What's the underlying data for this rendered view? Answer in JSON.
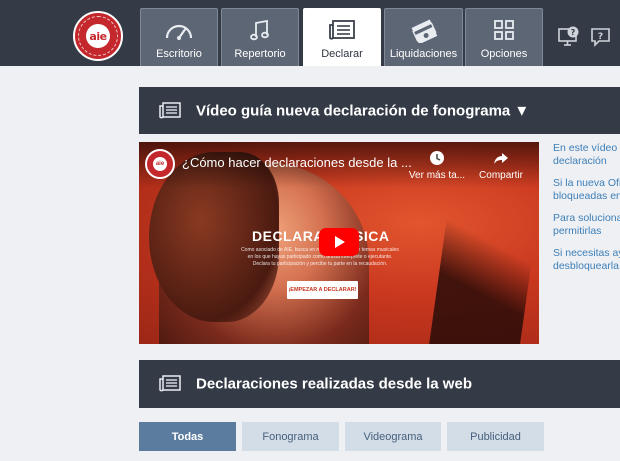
{
  "brand": {
    "logo_text": "aie"
  },
  "nav": {
    "tabs": [
      {
        "label": "Escritorio",
        "icon": "gauge-icon"
      },
      {
        "label": "Repertorio",
        "icon": "music-note-icon"
      },
      {
        "label": "Declarar",
        "icon": "document-list-icon",
        "active": true
      },
      {
        "label": "Liquidaciones",
        "icon": "money-stack-icon"
      },
      {
        "label": "Opciones",
        "icon": "grid-icon"
      }
    ],
    "right_icons": [
      "help-monitor-icon",
      "help-chat-icon"
    ]
  },
  "guide": {
    "title": "Vídeo guía nueva declaración de fonograma ▼"
  },
  "video": {
    "title": "¿Cómo hacer declaraciones desde la ...",
    "watch_later": "Ver más ta...",
    "share": "Compartir",
    "overlay_left": "DECLARA",
    "overlay_right": "SICA",
    "overlay_small": "Como asociado de AIE, busca en nuestro catálogo de temas musicales en los que hayas participado como artista intérprete o ejecutante. Declara tu participación y percibe tu parte en la recaudación.",
    "cta": "¡EMPEZAR A DECLARAR!"
  },
  "side_links": [
    {
      "lines": [
        "En este vídeo p",
        "declaración"
      ]
    },
    {
      "lines": [
        "Si la nueva Ofi",
        "bloqueadas en"
      ]
    },
    {
      "lines": [
        "Para solucional",
        "permitirlas"
      ]
    },
    {
      "lines": [
        "Si necesitas ay",
        "desbloquearla"
      ]
    }
  ],
  "declarations": {
    "title": "Declaraciones realizadas desde la web"
  },
  "filters": [
    {
      "label": "Todas",
      "active": true
    },
    {
      "label": "Fonograma"
    },
    {
      "label": "Videograma"
    },
    {
      "label": "Publicidad"
    }
  ],
  "colors": {
    "topbar": "#343b46",
    "tab": "#5d6675",
    "accent_red": "#c4282c",
    "link_blue": "#3d7fb8",
    "filter_active": "#5b7c9e",
    "filter_idle": "#d3dde8"
  }
}
